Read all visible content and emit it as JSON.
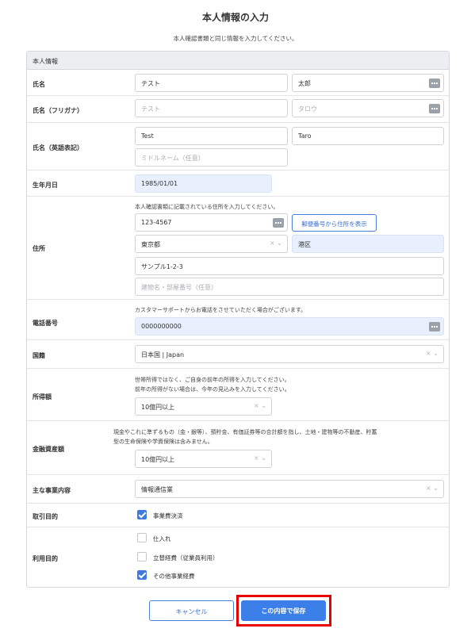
{
  "page": {
    "title": "本人情報の入力",
    "subtitle": "本人確認書類と同じ情報を入力してください。"
  },
  "section": {
    "header": "本人情報"
  },
  "name": {
    "label": "氏名",
    "last": "テスト",
    "first": "太郎"
  },
  "kana": {
    "label": "氏名（フリガナ）",
    "last": "テスト",
    "first": "タロウ"
  },
  "english": {
    "label": "氏名（英語表記）",
    "first": "Test",
    "last": "Taro",
    "middle_placeholder": "ミドルネーム（任意）"
  },
  "birth": {
    "label": "生年月日",
    "value": "1985/01/01"
  },
  "address": {
    "label": "住所",
    "note": "本人確認書類に記載されている住所を入力してください。",
    "postal": "123-4567",
    "lookup_button": "郵便番号から住所を表示",
    "prefecture": "東京都",
    "city": "港区",
    "street": "サンプル1-2-3",
    "building_placeholder": "建物名・部屋番号（任意）"
  },
  "phone": {
    "label": "電話番号",
    "note": "カスタマーサポートからお電話をさせていただく場合がございます。",
    "value": "0000000000"
  },
  "nationality": {
    "label": "国籍",
    "value": "日本国 | Japan"
  },
  "income": {
    "label": "所得額",
    "note1": "世帯所得ではなく、ご自身の前年の所得を入力してください。",
    "note2": "前年の所得がない場合は、今年の見込みを入力してください。",
    "value": "10億円以上"
  },
  "assets": {
    "label": "金融資産額",
    "note1": "現金やこれに準ずるもの（金・銀等）、預貯金、有価証券等の合計額を指し、土地・建物等の不動産、貯蓄",
    "note2": "型の生命保険や学資保険は含みません。",
    "value": "10億円以上"
  },
  "business": {
    "label": "主な事業内容",
    "value": "情報通信業"
  },
  "purpose": {
    "label": "取引目的",
    "option": "事業費決済",
    "checked": true
  },
  "usage": {
    "label": "利用目的",
    "options": [
      {
        "label": "仕入れ",
        "checked": false
      },
      {
        "label": "立替経費（従業員利用）",
        "checked": false
      },
      {
        "label": "その他事業経費",
        "checked": true
      }
    ]
  },
  "select_glyphs": "× ⌄",
  "actions": {
    "cancel": "キャンセル",
    "save": "この内容で保存"
  },
  "colors": {
    "accent": "#3d7fe8",
    "highlight": "#e60000",
    "autofill": "#e8f0fe"
  }
}
